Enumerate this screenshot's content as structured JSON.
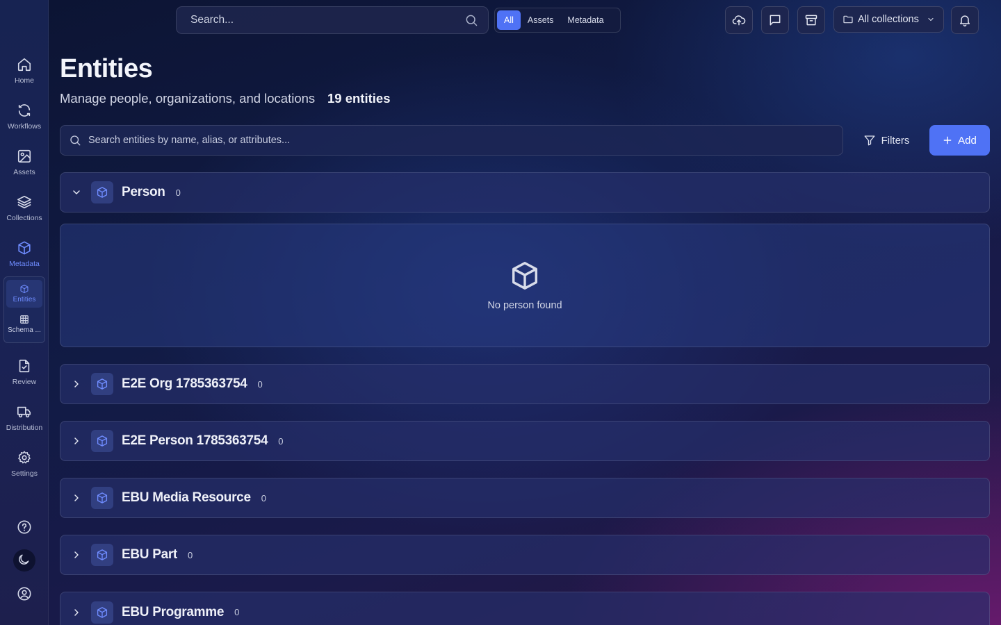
{
  "sidebar": {
    "items": [
      {
        "label": "Home",
        "icon": "home-icon"
      },
      {
        "label": "Workflows",
        "icon": "refresh-icon"
      },
      {
        "label": "Assets",
        "icon": "image-icon"
      },
      {
        "label": "Collections",
        "icon": "layers-icon"
      },
      {
        "label": "Metadata",
        "icon": "cube-icon",
        "active": true
      },
      {
        "label": "Review",
        "icon": "file-check-icon"
      },
      {
        "label": "Distribution",
        "icon": "truck-icon"
      },
      {
        "label": "Settings",
        "icon": "gear-icon"
      }
    ],
    "subnav": [
      {
        "label": "Entities",
        "icon": "cube-icon",
        "active": true
      },
      {
        "label": "Schema ...",
        "icon": "table-icon"
      }
    ],
    "bottom": [
      "help-icon",
      "moon-icon",
      "user-circle-icon"
    ]
  },
  "topbar": {
    "search_placeholder": "Search...",
    "scope_tabs": [
      "All",
      "Assets",
      "Metadata"
    ],
    "active_scope": "All",
    "buttons": [
      "upload-cloud-icon",
      "message-icon",
      "archive-icon",
      "bell-icon"
    ],
    "collections_label": "All collections"
  },
  "page": {
    "title": "Entities",
    "subtitle": "Manage people, organizations, and locations",
    "count": "19 entities",
    "search_placeholder": "Search entities by name, alias, or attributes...",
    "filters_label": "Filters",
    "add_label": "Add"
  },
  "groups": [
    {
      "name": "Person",
      "count": "0",
      "expanded": true
    },
    {
      "name": "E2E Org 1785363754",
      "count": "0"
    },
    {
      "name": "E2E Person 1785363754",
      "count": "0"
    },
    {
      "name": "EBU Media Resource",
      "count": "0"
    },
    {
      "name": "EBU Part",
      "count": "0"
    },
    {
      "name": "EBU Programme",
      "count": "0"
    }
  ],
  "empty_state": {
    "text": "No person found"
  },
  "colors": {
    "accent": "#4f72f5",
    "accent_icon": "#6f8cff"
  }
}
